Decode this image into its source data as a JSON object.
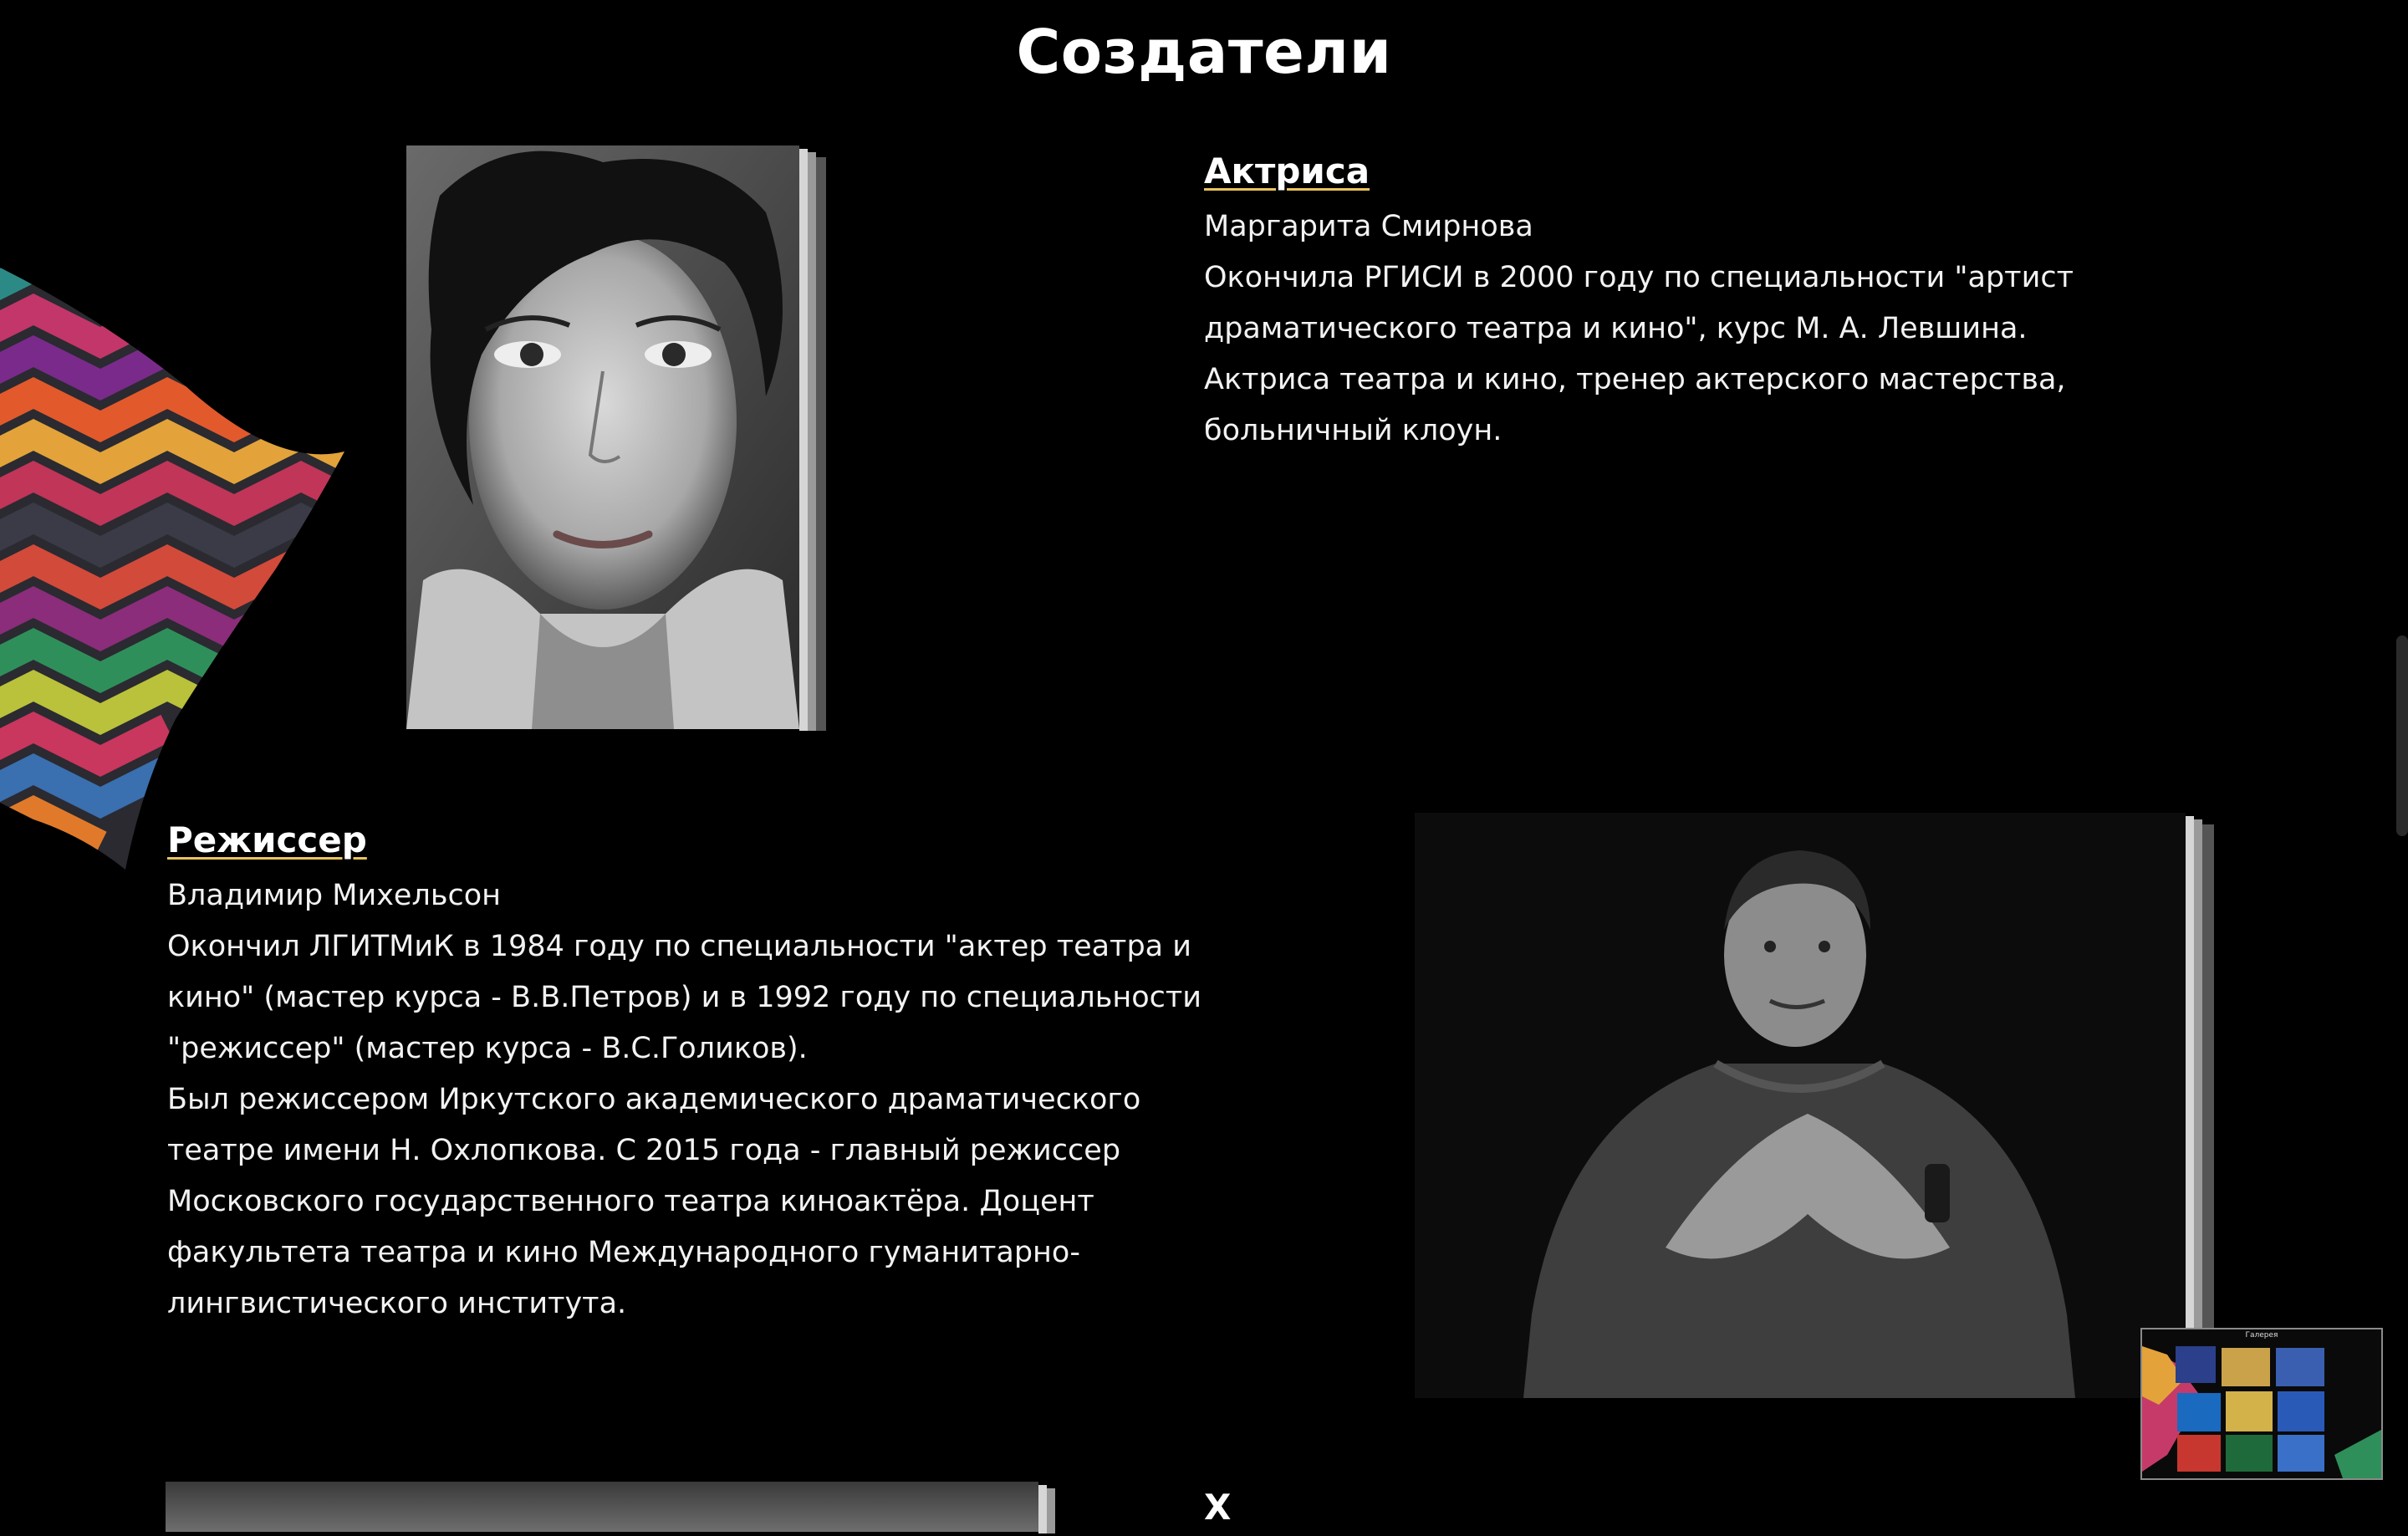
{
  "page_title": "Создатели",
  "creators": [
    {
      "role": "Актриса",
      "name": "Маргарита Смирнова",
      "bio_lines": [
        "Окончила РГИСИ в 2000 году по специальности \"артист",
        "драматического театра и кино\", курс М. А. Левшина.",
        "Актриса театра и кино, тренер актерского мастерства,",
        "больничный клоун."
      ]
    },
    {
      "role": "Режиссер",
      "name": "Владимир Михельсон",
      "bio_lines": [
        "Окончил ЛГИТМиК в 1984 году по специальности \"актер театра и",
        "кино\" (мастер курса - В.В.Петров) и в 1992 году по специальности",
        "\"режиссер\" (мастер курса - В.С.Голиков).",
        "Был режиссером Иркутского академического драматического",
        "театре имени Н. Охлопкова. С 2015 года - главный режиссер",
        "Московского государственного театра киноактёра. Доцент",
        "факультета театра и кино Международного гуманитарно-",
        "лингвистического института."
      ]
    },
    {
      "role": "Х"
    }
  ],
  "gallery_widget": {
    "title": "Галерея"
  }
}
